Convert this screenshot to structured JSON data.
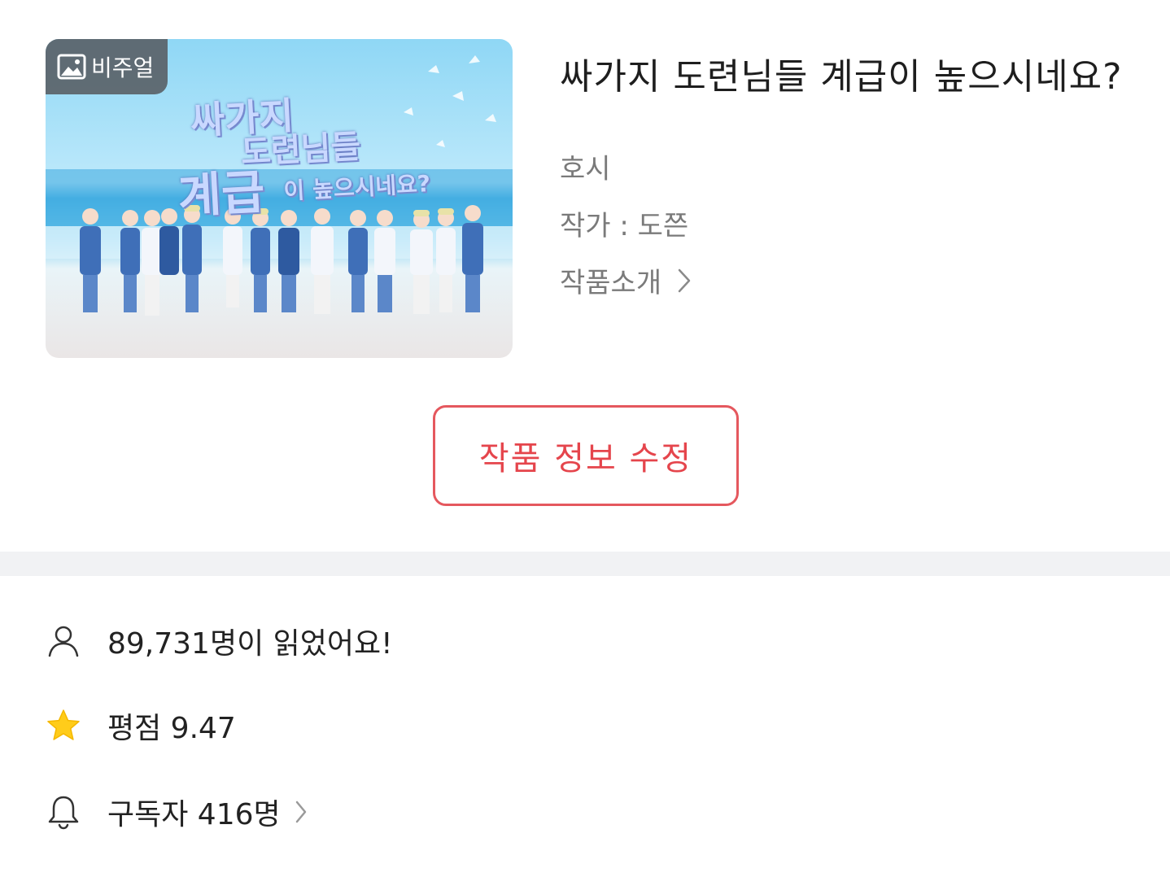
{
  "cover": {
    "badge_label": "비주얼",
    "title_lines": [
      "싸가지",
      "도련님들",
      "계급",
      "이 높으시네요?"
    ]
  },
  "work": {
    "title": "싸가지 도련님들 계급이 높으시네요?",
    "genre": "호시",
    "author": "작가 : 도쯘",
    "intro_link": "작품소개"
  },
  "edit_button_label": "작품 정보 수정",
  "stats": {
    "readers": "89,731명이 읽었어요!",
    "rating": "평점 9.47",
    "subscribers": "구독자 416명"
  },
  "colors": {
    "accent": "#e5585e",
    "star": "#ffcc1a",
    "badge_bg": "#5a6268",
    "divider": "#f1f2f4"
  },
  "icons": {
    "badge": "image-icon",
    "intro": "chevron-right-icon",
    "readers": "user-icon",
    "rating": "star-icon",
    "subscribers": "bell-icon"
  }
}
